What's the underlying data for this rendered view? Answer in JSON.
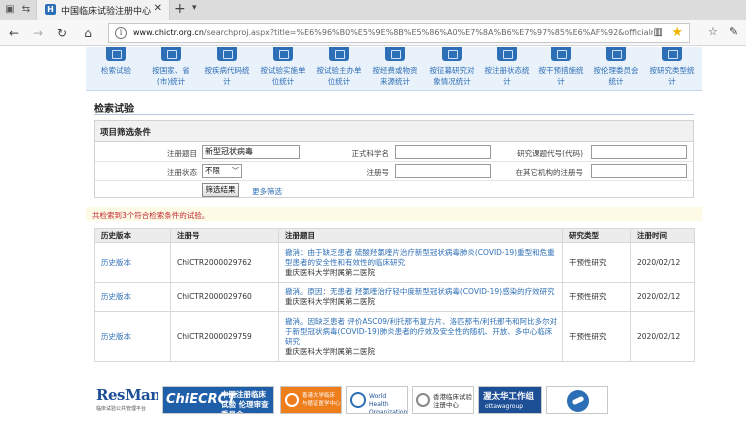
{
  "browser": {
    "tab_title": "中国临床试验注册中心",
    "tab_favicon": "H",
    "url_host": "www.chictr.org.cn",
    "url_rest": "/searchproj.aspx?title=%E6%96%B0%E5%9E%8B%E5%86%A0%E7%8A%B6%E7%97%85%E6%AF%92&officialname=&subjectid=",
    "accent": "#2d6fb6"
  },
  "stats_nav": [
    {
      "label": "检索试验"
    },
    {
      "label": "按国家、省(市)统计"
    },
    {
      "label": "按疾病代码统计"
    },
    {
      "label": "按试验实施单位统计"
    },
    {
      "label": "按试验主办单位统计"
    },
    {
      "label": "按经费或物资来源统计"
    },
    {
      "label": "按征募研究对象情况统计"
    },
    {
      "label": "按注册状态统计"
    },
    {
      "label": "按干预措施统计"
    },
    {
      "label": "按伦理委员会统计"
    },
    {
      "label": "按研究类型统计"
    }
  ],
  "page": {
    "heading": "检索试验"
  },
  "filter": {
    "title": "项目筛选条件",
    "label_title": "注册题目",
    "value_title": "新型冠状病毒",
    "label_official": "正式科学名",
    "label_code": "研究课题代号(代码)",
    "label_status": "注册状态",
    "value_status": "不限",
    "label_regno": "注册号",
    "label_other_regno": "在其它机构的注册号",
    "btn_filter": "筛选结果",
    "link_more": "更多筛选"
  },
  "notice": {
    "text": "共检索到3个符合检索条件的试验。"
  },
  "table": {
    "headers": [
      "历史版本",
      "注册号",
      "注册题目",
      "研究类型",
      "注册时间"
    ],
    "rows": [
      {
        "history": "历史版本",
        "regno": "ChiCTR2000029762",
        "title": "撤消：由于缺乏患者 硫酸羟氯喹片治疗新型冠状病毒肺炎(COVID-19)重型和危重型患者的安全性和有效性的临床研究",
        "institution": "重庆医科大学附属第二医院",
        "type": "干预性研究",
        "date": "2020/02/12"
      },
      {
        "history": "历史版本",
        "regno": "ChiCTR2000029760",
        "title": "撤消。原因：无患者 羟氯喹治疗轻中度新型冠状病毒(COVID-19)感染的疗效研究",
        "institution": "重庆医科大学附属第二医院",
        "type": "干预性研究",
        "date": "2020/02/12"
      },
      {
        "history": "历史版本",
        "regno": "ChiCTR2000029759",
        "title": "撤消。因缺乏患者 评价ASC09/利托那韦复方片、洛匹那韦/利托那韦和阿比多尔对于新型冠状病毒(COVID-19)肺炎患者的疗效及安全性的随机、开放、多中心临床研究",
        "institution": "重庆医科大学附属第二医院",
        "type": "干预性研究",
        "date": "2020/02/12"
      }
    ]
  },
  "logos": {
    "resman": "ResMan",
    "resman_sub": "临床试验公共管理平台",
    "chictr_a": "ChiECRCT",
    "chictr_b": "中国注册临床试验 伦理审查委员会",
    "orange": "香港大学临床 与循证医学中心",
    "who": "World Health Organization",
    "hk": "香港临床试验注册中心",
    "otta_a": "渥太华工作组",
    "otta_b": "ottawagroup"
  }
}
